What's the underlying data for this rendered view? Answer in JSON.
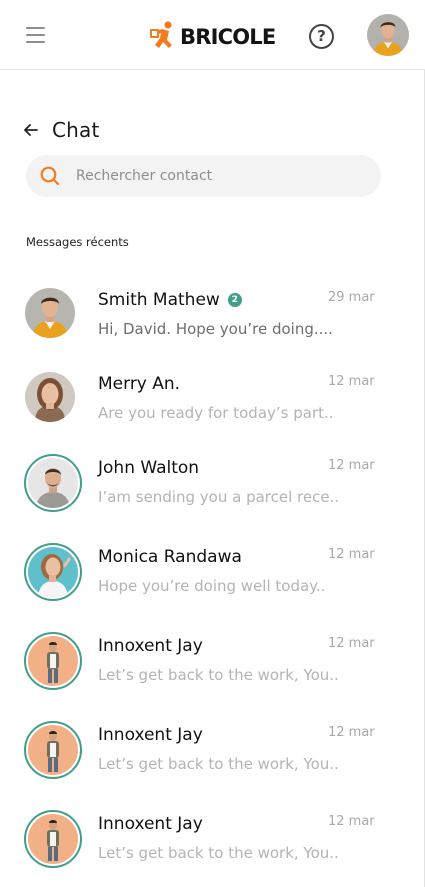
{
  "header": {
    "brand": "BRICOLE",
    "help_symbol": "?",
    "menu_icon": "hamburger-menu-icon",
    "help_icon": "question-circle-icon",
    "brand_color": "#f47b20"
  },
  "chat": {
    "title": "Chat",
    "back_icon": "arrow-left-icon"
  },
  "search": {
    "placeholder": "Rechercher contact",
    "icon": "search-icon",
    "icon_color": "#f47b20"
  },
  "section_label": "Messages récents",
  "accent_color": "#3f9f8b",
  "conversations": [
    {
      "name": "Smith Mathew",
      "date": "29 mar",
      "preview": "Hi, David. Hope you’re doing....",
      "unread_count": "2"
    },
    {
      "name": "Merry An.",
      "date": "12 mar",
      "preview": "Are you ready for today’s part.."
    },
    {
      "name": "John Walton",
      "date": "12 mar",
      "preview": "I’am sending you a parcel rece.."
    },
    {
      "name": "Monica Randawa",
      "date": "12 mar",
      "preview": "Hope you’re doing well today.."
    },
    {
      "name": "Innoxent Jay",
      "date": "12 mar",
      "preview": "Let’s get back to the work, You.."
    },
    {
      "name": "Innoxent Jay",
      "date": "12 mar",
      "preview": "Let’s get back to the work, You.."
    },
    {
      "name": "Innoxent Jay",
      "date": "12 mar",
      "preview": "Let’s get back to the work, You.."
    }
  ]
}
